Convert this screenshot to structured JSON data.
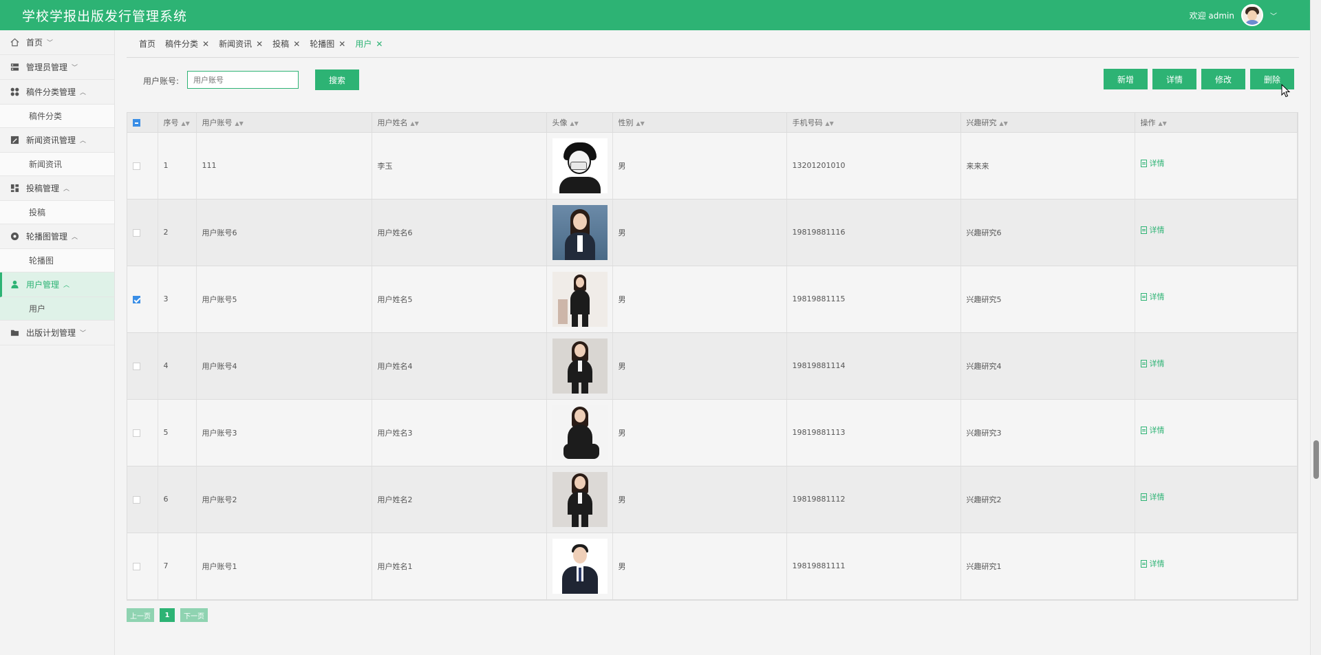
{
  "header": {
    "title": "学校学报出版发行管理系统",
    "welcome": "欢迎 admin",
    "chevron": "﹀"
  },
  "sidebar": {
    "items": [
      {
        "label": "首页",
        "icon": "home-icon",
        "chevron": "﹀"
      },
      {
        "label": "管理员管理",
        "icon": "server-icon",
        "chevron": "﹀"
      },
      {
        "label": "稿件分类管理",
        "icon": "grid-icon",
        "chevron": "︿"
      },
      {
        "label": "稿件分类",
        "sub": true
      },
      {
        "label": "新闻资讯管理",
        "icon": "edit-icon",
        "chevron": "︿"
      },
      {
        "label": "新闻资讯",
        "sub": true
      },
      {
        "label": "投稿管理",
        "icon": "dashboard-icon",
        "chevron": "︿"
      },
      {
        "label": "投稿",
        "sub": true
      },
      {
        "label": "轮播图管理",
        "icon": "record-icon",
        "chevron": "︿"
      },
      {
        "label": "轮播图",
        "sub": true
      },
      {
        "label": "用户管理",
        "icon": "user-icon",
        "chevron": "︿",
        "active": true
      },
      {
        "label": "用户",
        "sub": true,
        "active": true
      },
      {
        "label": "出版计划管理",
        "icon": "folder-icon",
        "chevron": "﹀"
      }
    ]
  },
  "tabs": [
    {
      "label": "首页",
      "closable": false
    },
    {
      "label": "稿件分类",
      "closable": true
    },
    {
      "label": "新闻资讯",
      "closable": true
    },
    {
      "label": "投稿",
      "closable": true
    },
    {
      "label": "轮播图",
      "closable": true
    },
    {
      "label": "用户",
      "closable": true,
      "active": true
    }
  ],
  "search": {
    "label": "用户账号:",
    "placeholder": "用户账号",
    "button": "搜索"
  },
  "actions": {
    "add": "新增",
    "detail": "详情",
    "edit": "修改",
    "delete": "删除"
  },
  "table": {
    "columns": [
      "序号",
      "用户账号",
      "用户姓名",
      "头像",
      "性别",
      "手机号码",
      "兴趣研究",
      "操作"
    ],
    "detail_label": "详情",
    "rows": [
      {
        "no": "1",
        "account": "111",
        "name": "李玉",
        "gender": "男",
        "phone": "13201201010",
        "interest": "来来来",
        "checked": false
      },
      {
        "no": "2",
        "account": "用户账号6",
        "name": "用户姓名6",
        "gender": "男",
        "phone": "19819881116",
        "interest": "兴趣研究6",
        "checked": false
      },
      {
        "no": "3",
        "account": "用户账号5",
        "name": "用户姓名5",
        "gender": "男",
        "phone": "19819881115",
        "interest": "兴趣研究5",
        "checked": true
      },
      {
        "no": "4",
        "account": "用户账号4",
        "name": "用户姓名4",
        "gender": "男",
        "phone": "19819881114",
        "interest": "兴趣研究4",
        "checked": false
      },
      {
        "no": "5",
        "account": "用户账号3",
        "name": "用户姓名3",
        "gender": "男",
        "phone": "19819881113",
        "interest": "兴趣研究3",
        "checked": false
      },
      {
        "no": "6",
        "account": "用户账号2",
        "name": "用户姓名2",
        "gender": "男",
        "phone": "19819881112",
        "interest": "兴趣研究2",
        "checked": false
      },
      {
        "no": "7",
        "account": "用户账号1",
        "name": "用户姓名1",
        "gender": "男",
        "phone": "19819881111",
        "interest": "兴趣研究1",
        "checked": false
      }
    ]
  },
  "pagination": {
    "prev": "上一页",
    "current": "1",
    "next": "下一页"
  },
  "colors": {
    "accent": "#2db374",
    "checkbox": "#3a8ee6"
  }
}
